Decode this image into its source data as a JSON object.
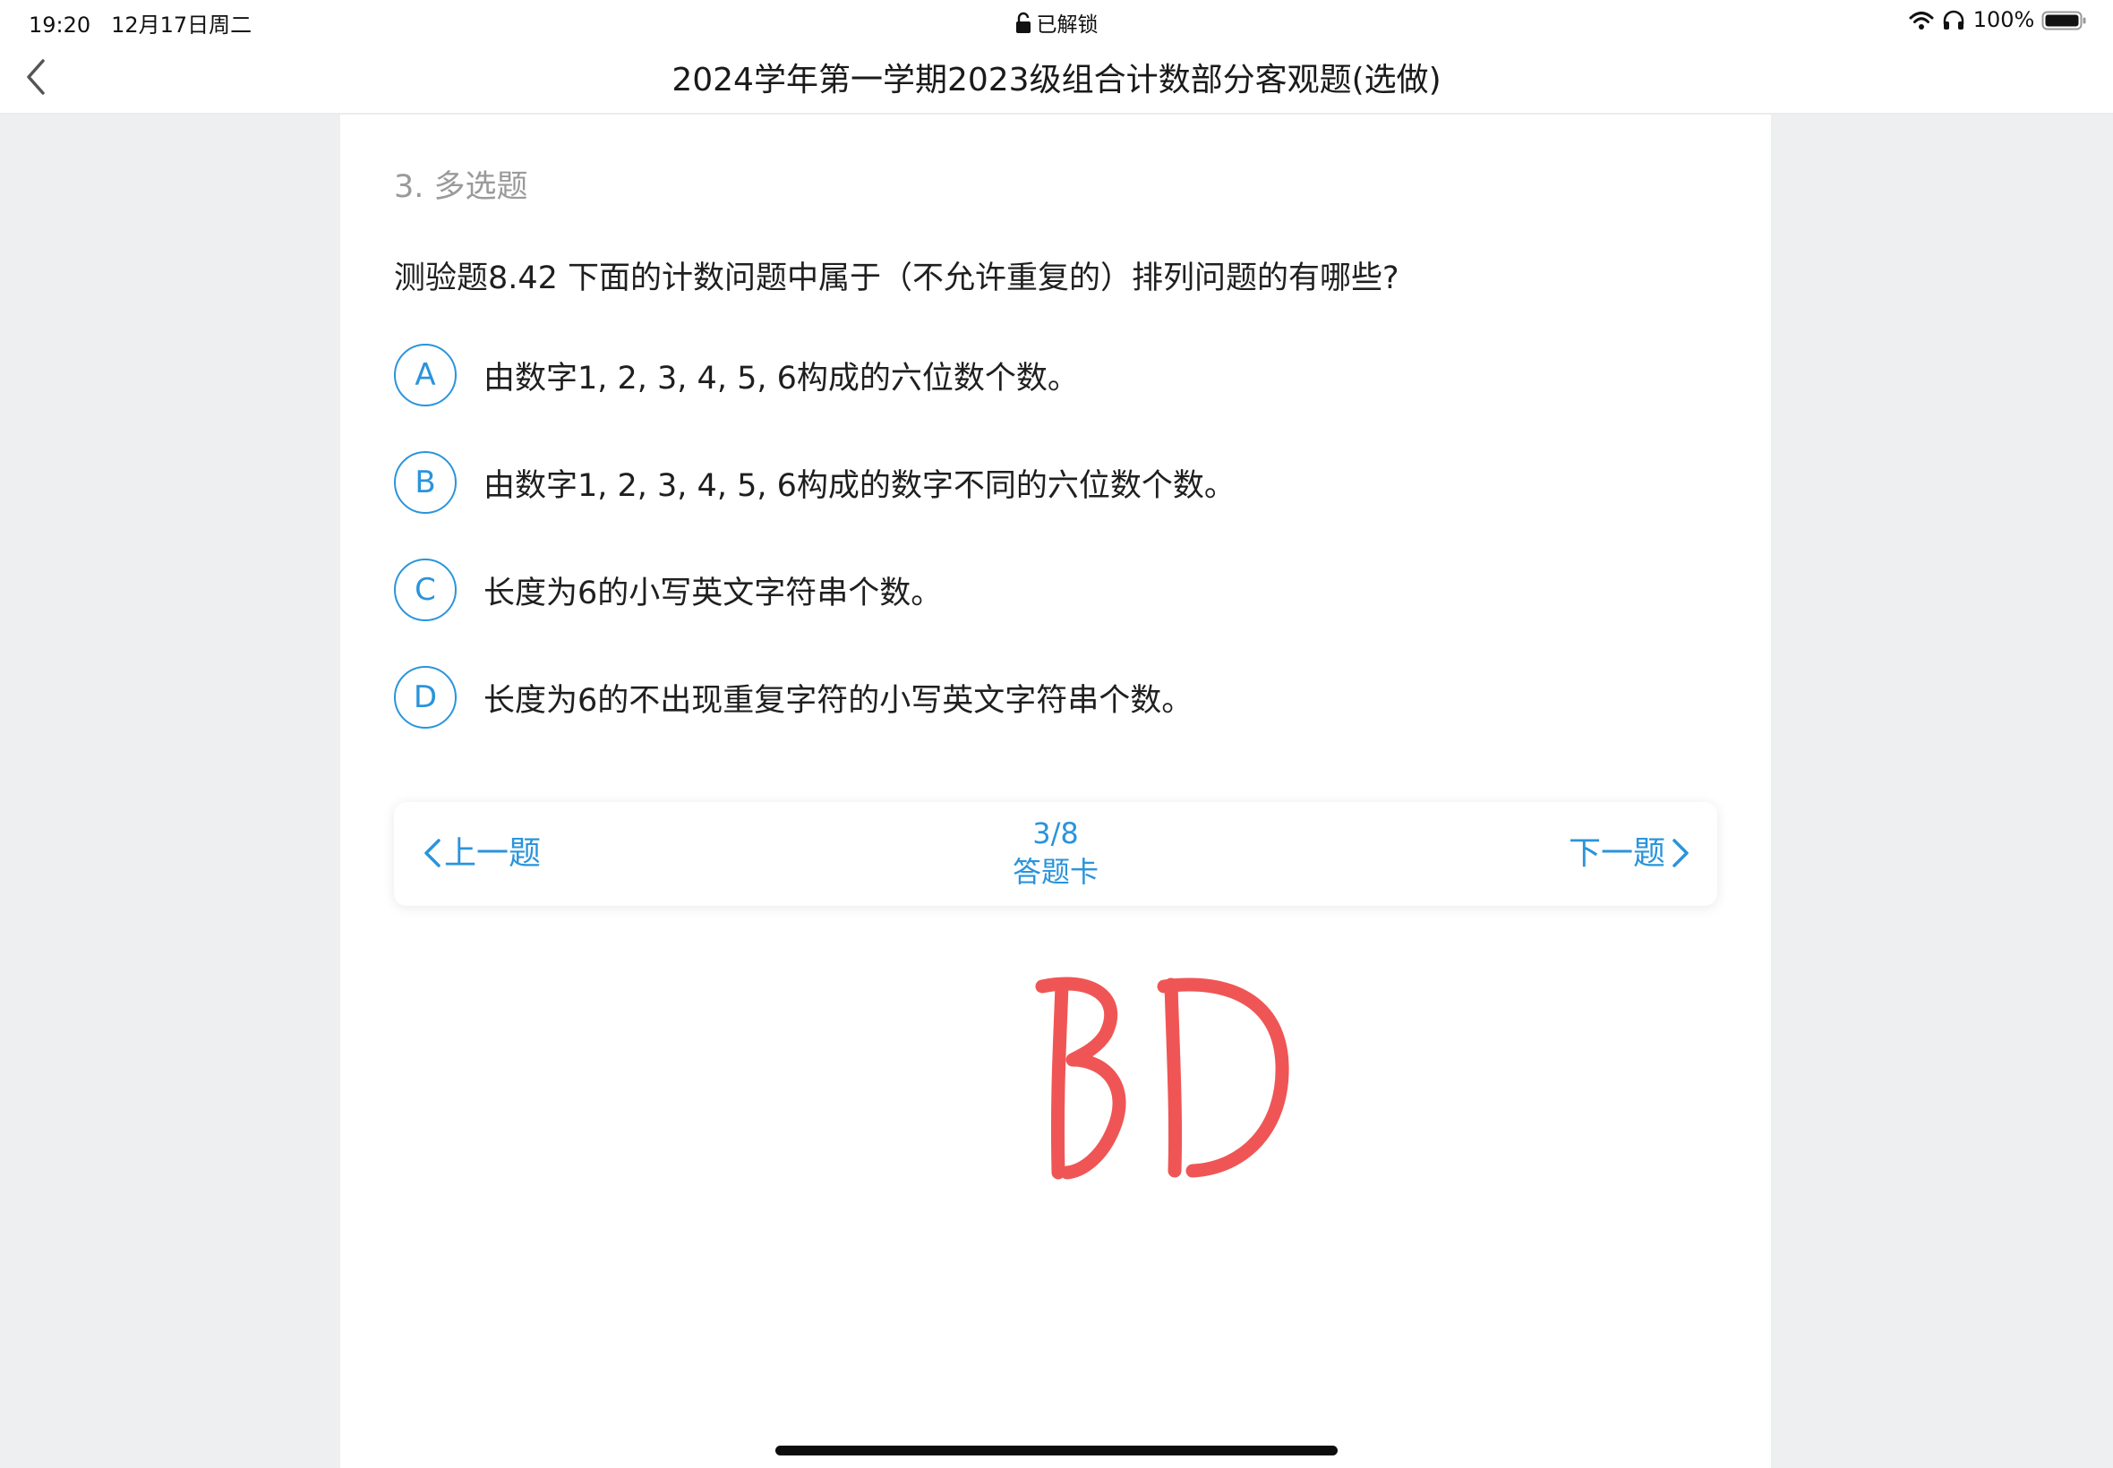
{
  "status_bar": {
    "time": "19:20",
    "date": "12月17日周二",
    "lock_status": "已解锁",
    "battery": "100%",
    "icons": [
      "lock-icon",
      "wifi-icon",
      "headphones-icon",
      "battery-icon"
    ]
  },
  "nav": {
    "back_icon": "chevron-left-icon",
    "title": "2024学年第一学期2023级组合计数部分客观题(选做)"
  },
  "question": {
    "type_label": "3. 多选题",
    "text": "测验题8.42 下面的计数问题中属于（不允许重复的）排列问题的有哪些?",
    "options": [
      {
        "letter": "A",
        "text": "由数字1, 2, 3, 4, 5, 6构成的六位数个数。"
      },
      {
        "letter": "B",
        "text": "由数字1, 2, 3, 4, 5, 6构成的数字不同的六位数个数。"
      },
      {
        "letter": "C",
        "text": "长度为6的小写英文字符串个数。"
      },
      {
        "letter": "D",
        "text": "长度为6的不出现重复字符的小写英文字符串个数。"
      }
    ]
  },
  "pager": {
    "prev_label": "上一题",
    "next_label": "下一题",
    "page_indicator": "3/8",
    "answer_card_label": "答题卡"
  },
  "handwritten_answer": "BD",
  "colors": {
    "accent": "#2a94dc",
    "handwriting": "#f05555",
    "background": "#eeeff1",
    "panel": "#ffffff"
  }
}
